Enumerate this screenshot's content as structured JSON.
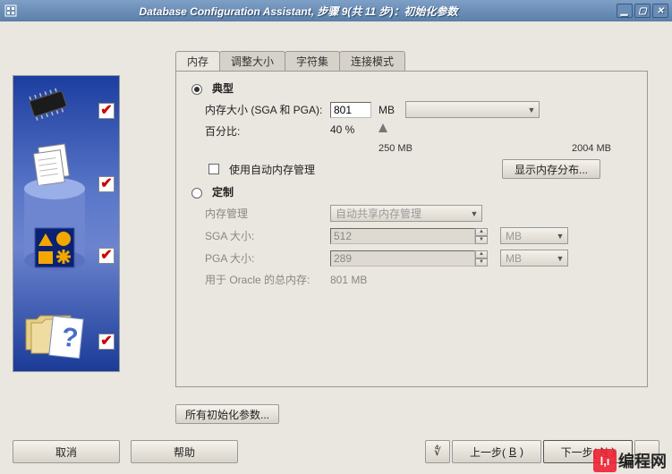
{
  "window": {
    "title": "Database Configuration Assistant, 步骤 9(共 11 步)：初始化参数"
  },
  "tabs": {
    "memory": "内存",
    "sizing": "调整大小",
    "charset": "字符集",
    "connmode": "连接模式"
  },
  "memory": {
    "typical_label": "典型",
    "mem_size_label": "内存大小 (SGA 和 PGA):",
    "mem_size_value": "801",
    "mem_unit": "MB",
    "percent_label": "百分比:",
    "percent_value": "40 %",
    "slider_min_label": "250 MB",
    "slider_max_label": "2004 MB",
    "auto_mem_label": "使用自动内存管理",
    "show_dist_btn": "显示内存分布...",
    "custom_label": "定制",
    "mem_mgmt_label": "内存管理",
    "mem_mgmt_value": "自动共享内存管理",
    "sga_label": "SGA 大小:",
    "sga_value": "512",
    "sga_unit": "MB",
    "pga_label": "PGA 大小:",
    "pga_value": "289",
    "pga_unit": "MB",
    "total_label": "用于 Oracle 的总内存:",
    "total_value": "801 MB"
  },
  "buttons": {
    "all_params": "所有初始化参数...",
    "cancel": "取消",
    "help": "帮助",
    "back_pre": "上一步(",
    "back_mn": "B",
    "back_post": ")",
    "next_pre": "下一步(",
    "next_mn": "N",
    "next_post": ")"
  },
  "watermark": {
    "badge": "l,ı",
    "text": "编程网"
  }
}
